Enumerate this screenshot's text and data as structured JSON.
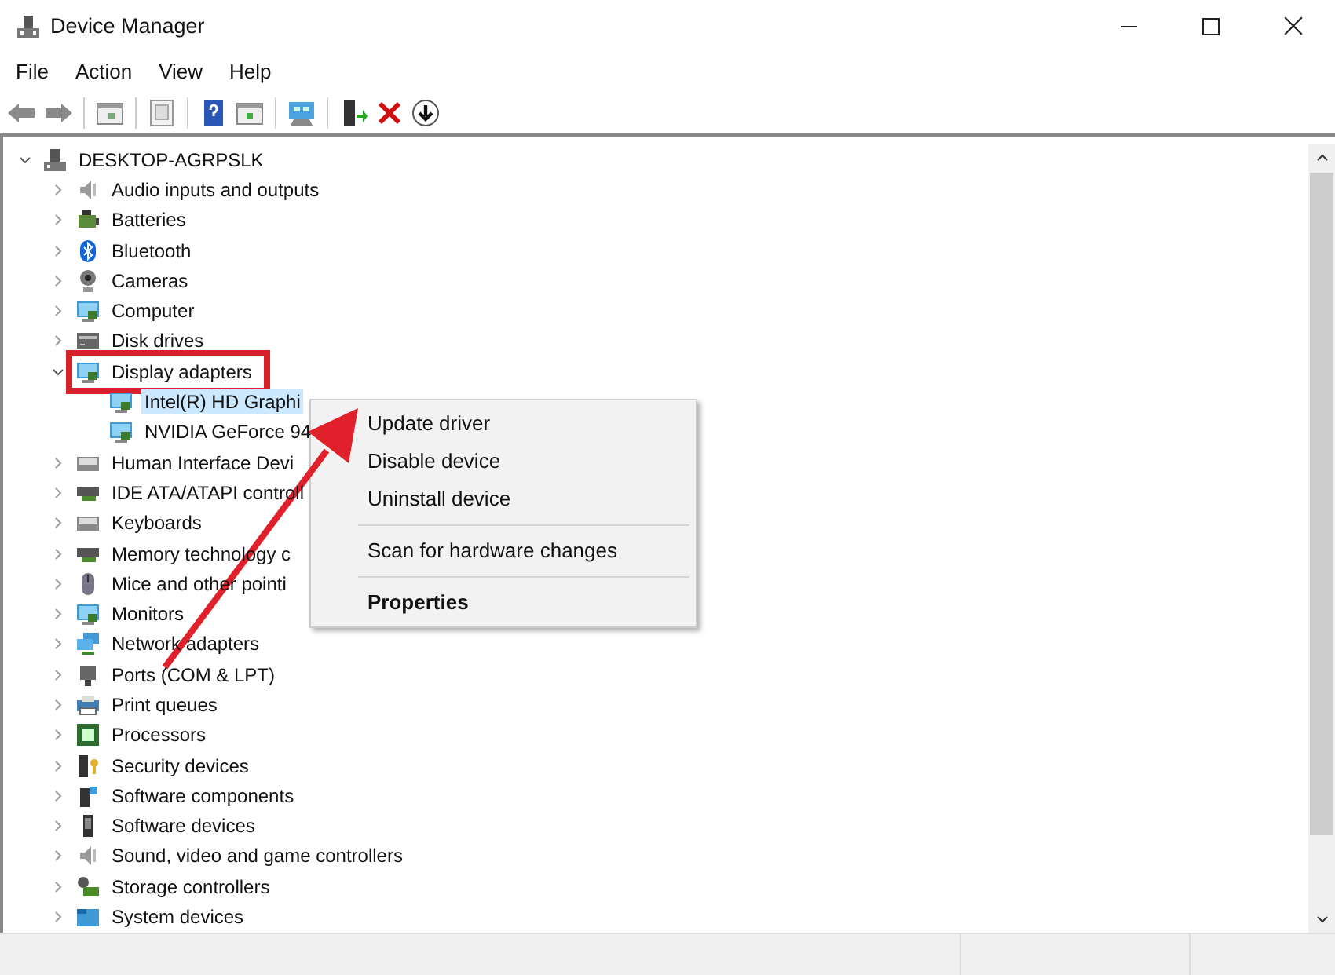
{
  "window": {
    "title": "Device Manager"
  },
  "menu": [
    "File",
    "Action",
    "View",
    "Help"
  ],
  "tree": {
    "label": "DESKTOP-AGRPSLK",
    "expanded": true,
    "selected": false,
    "children": [
      {
        "label": "Audio inputs and outputs",
        "expanded": false,
        "selected": false
      },
      {
        "label": "Batteries",
        "expanded": false,
        "selected": false
      },
      {
        "label": "Bluetooth",
        "expanded": false,
        "selected": false
      },
      {
        "label": "Cameras",
        "expanded": false,
        "selected": false
      },
      {
        "label": "Computer",
        "expanded": false,
        "selected": false
      },
      {
        "label": "Disk drives",
        "expanded": false,
        "selected": false
      },
      {
        "label": "Display adapters",
        "expanded": true,
        "selected": false,
        "highlighted": true,
        "children": [
          {
            "label": "Intel(R) HD Graphi",
            "selected": true
          },
          {
            "label": "NVIDIA GeForce 94",
            "selected": false
          }
        ]
      },
      {
        "label": "Human Interface Devi",
        "expanded": false,
        "selected": false
      },
      {
        "label": "IDE ATA/ATAPI controll",
        "expanded": false,
        "selected": false
      },
      {
        "label": "Keyboards",
        "expanded": false,
        "selected": false
      },
      {
        "label": "Memory technology c",
        "expanded": false,
        "selected": false
      },
      {
        "label": "Mice and other pointi",
        "expanded": false,
        "selected": false
      },
      {
        "label": "Monitors",
        "expanded": false,
        "selected": false
      },
      {
        "label": "Network adapters",
        "expanded": false,
        "selected": false
      },
      {
        "label": "Ports (COM & LPT)",
        "expanded": false,
        "selected": false
      },
      {
        "label": "Print queues",
        "expanded": false,
        "selected": false
      },
      {
        "label": "Processors",
        "expanded": false,
        "selected": false
      },
      {
        "label": "Security devices",
        "expanded": false,
        "selected": false
      },
      {
        "label": "Software components",
        "expanded": false,
        "selected": false
      },
      {
        "label": "Software devices",
        "expanded": false,
        "selected": false
      },
      {
        "label": "Sound, video and game controllers",
        "expanded": false,
        "selected": false
      },
      {
        "label": "Storage controllers",
        "expanded": false,
        "selected": false
      },
      {
        "label": "System devices",
        "expanded": false,
        "selected": false
      }
    ]
  },
  "context_menu": {
    "groups": [
      [
        {
          "label": "Update driver",
          "default": false
        },
        {
          "label": "Disable device",
          "default": false
        },
        {
          "label": "Uninstall device",
          "default": false
        }
      ],
      [
        {
          "label": "Scan for hardware changes",
          "default": false
        }
      ],
      [
        {
          "label": "Properties",
          "default": true
        }
      ]
    ]
  },
  "annotation": {
    "kind": "arrow"
  }
}
